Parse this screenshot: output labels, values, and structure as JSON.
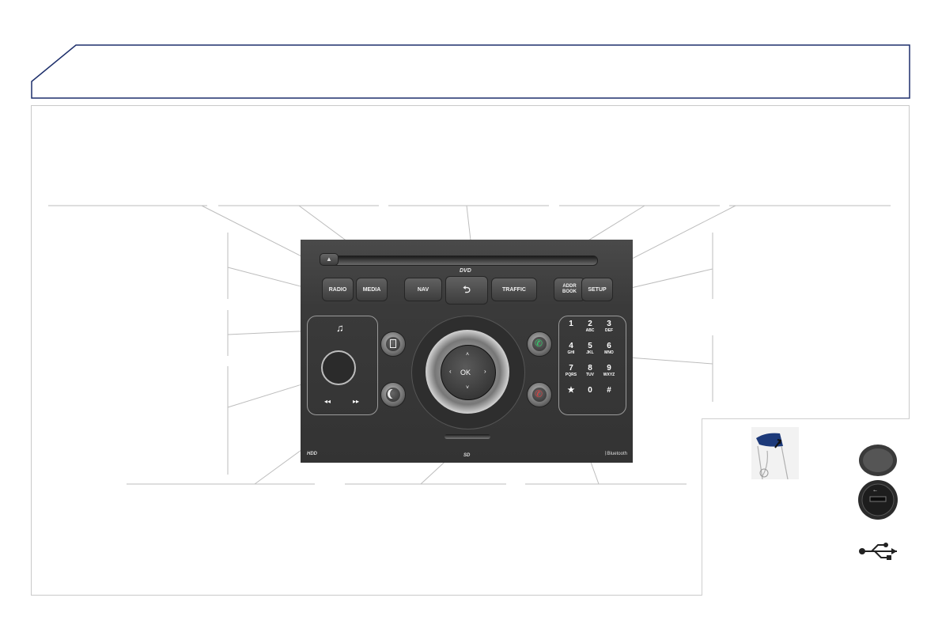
{
  "colors": {
    "frame_blue": "#1d2f6b",
    "frame_grey": "#c9c9c9",
    "callout_line": "#bdbdbd"
  },
  "faceplate": {
    "eject_symbol": "▲",
    "dvd_logo": "DVD",
    "buttons": {
      "radio": "RADIO",
      "media": "MEDIA",
      "nav": "NAV",
      "back_symbol": "⮌",
      "traffic": "TRAFFIC",
      "addr_book": "ADDR BOOK",
      "setup": "SETUP"
    },
    "music_symbol": "♫",
    "seek_back_symbol": "◂◂",
    "seek_fwd_symbol": "▸▸",
    "ok_label": "OK",
    "keypad": [
      {
        "digit": "1",
        "letters": ""
      },
      {
        "digit": "2",
        "letters": "ABC"
      },
      {
        "digit": "3",
        "letters": "DEF"
      },
      {
        "digit": "4",
        "letters": "GHI"
      },
      {
        "digit": "5",
        "letters": "JKL"
      },
      {
        "digit": "6",
        "letters": "MNO"
      },
      {
        "digit": "7",
        "letters": "PQRS"
      },
      {
        "digit": "8",
        "letters": "TUV"
      },
      {
        "digit": "9",
        "letters": "WXYZ"
      },
      {
        "digit": "★",
        "letters": ""
      },
      {
        "digit": "0",
        "letters": ""
      },
      {
        "digit": "#",
        "letters": ""
      }
    ],
    "hdd_label": "HDD",
    "bluetooth_label": "Bluetooth",
    "sd_label": "SD"
  },
  "icons": [
    "eject-icon",
    "back-icon",
    "music-note-icon",
    "screen-icon",
    "moon-icon",
    "phone-answer-icon",
    "phone-hangup-icon",
    "usb-symbol-icon",
    "usb-socket-icon",
    "armrest-illustration-icon"
  ]
}
